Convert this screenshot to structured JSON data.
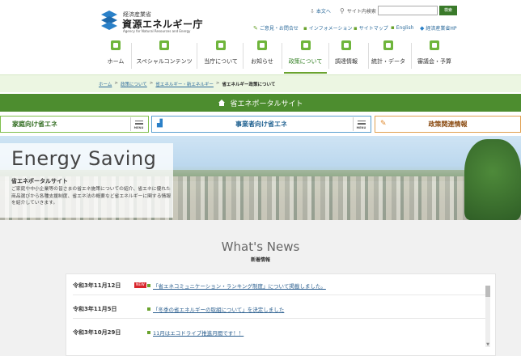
{
  "header": {
    "logo": {
      "ministry": "経済産業省",
      "agency": "資源エネルギー庁",
      "agency_en": "Agency for Natural Resources and Energy"
    },
    "top_links": [
      {
        "label": "本文へ",
        "icon": "download-arrow-icon"
      },
      {
        "label": "サイト内検索",
        "icon": "search-icon"
      }
    ],
    "search": {
      "button": "検索",
      "value": "",
      "placeholder": ""
    },
    "sub_links": [
      {
        "label": "ご意見・お問合せ",
        "icon": "pencil-icon"
      },
      {
        "label": "インフォメーション",
        "icon": "link-icon"
      },
      {
        "label": "サイトマップ",
        "icon": "link-icon"
      },
      {
        "label": "English",
        "icon": "link-icon"
      },
      {
        "label": "経済産業省HP",
        "icon": "meti-logo-icon"
      }
    ]
  },
  "nav": {
    "items": [
      {
        "label": "ホーム",
        "icon": "home-icon"
      },
      {
        "label": "スペシャルコンテンツ",
        "icon": "star-icon"
      },
      {
        "label": "当庁について",
        "icon": "building-icon"
      },
      {
        "label": "お知らせ",
        "icon": "bell-icon"
      },
      {
        "label": "政策について",
        "icon": "document-icon"
      },
      {
        "label": "調達情報",
        "icon": "mail-icon"
      },
      {
        "label": "統計・データ",
        "icon": "chart-icon"
      },
      {
        "label": "審議会・予算",
        "icon": "people-icon"
      }
    ]
  },
  "breadcrumb": {
    "items": [
      "ホーム",
      "政策について",
      "省エネルギー・新エネルギー"
    ],
    "current": "省エネルギー政策について"
  },
  "portal": {
    "title": "省エネポータルサイト"
  },
  "tabs": {
    "home": "家庭向け省エネ",
    "business": "事業者向け省エネ",
    "policy": "政策関連情報",
    "menu_label": "MENU"
  },
  "hero": {
    "heading": "Energy Saving",
    "subheading": "省エネポータルサイト",
    "description": "ご家庭や中小企業等の皆さまの省エネ施策についての紹介、省エネに優れた商品選びから各種支援制度、省エネ法の概要など省エネルギーに関する情報を紹介していきます。"
  },
  "whats_new": {
    "title": "What's News",
    "subtitle": "新着情報",
    "items": [
      {
        "date": "令和3年11月12日",
        "badge": "NEW",
        "text": "「省エネコミュニケーション・ランキング制度」について掲載しました。"
      },
      {
        "date": "令和3年11月5日",
        "badge": "",
        "text": "「冬季の省エネルギーの取組について」を決定しました"
      },
      {
        "date": "令和3年10月29日",
        "badge": "",
        "text": "11月はエコドライブ推進月間です！！"
      }
    ]
  },
  "colors": {
    "brand_green": "#4d8d2f",
    "nav_icon_green": "#6fb53c",
    "link_blue": "#2b6a9b",
    "new_badge": "#d9262c"
  }
}
